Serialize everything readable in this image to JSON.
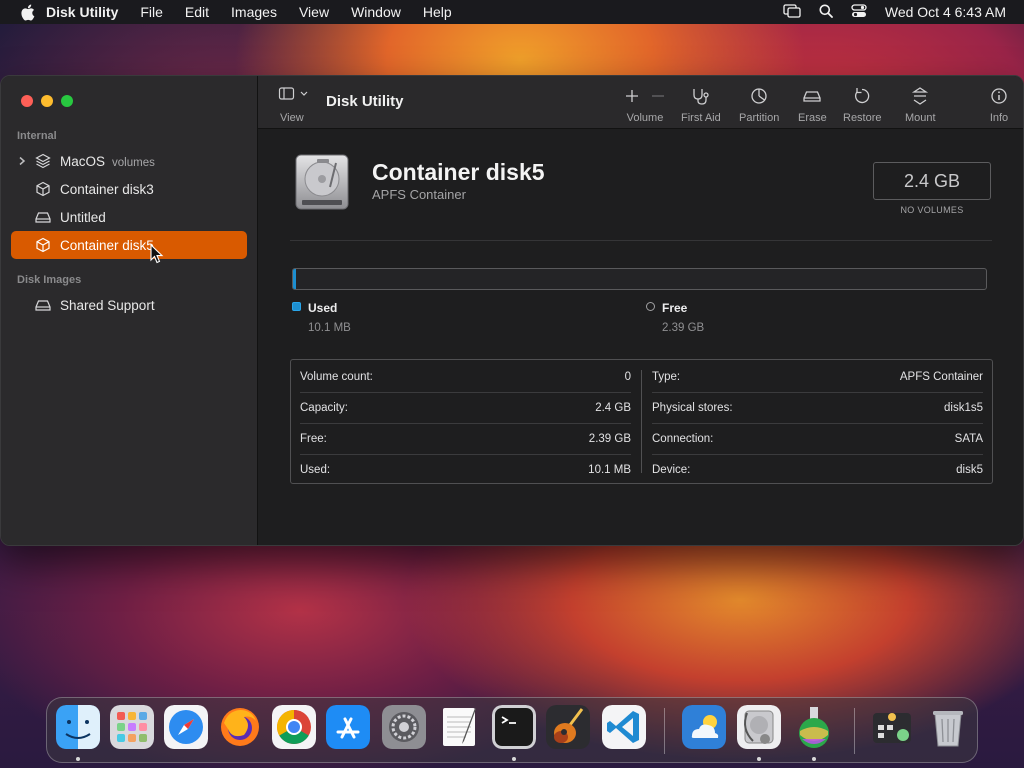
{
  "menubar": {
    "app_name": "Disk Utility",
    "items": [
      "File",
      "Edit",
      "Images",
      "View",
      "Window",
      "Help"
    ],
    "clock": "Wed Oct 4  6:43 AM"
  },
  "sidebar": {
    "section_internal": "Internal",
    "section_disk_images": "Disk Images",
    "items": [
      {
        "label": "MacOS",
        "sublabel": "volumes",
        "icon": "layers-icon"
      },
      {
        "label": "Container disk3",
        "icon": "cube-icon"
      },
      {
        "label": "Untitled",
        "icon": "drive-icon"
      },
      {
        "label": "Container disk5",
        "icon": "cube-icon",
        "selected": true
      },
      {
        "label": "Shared Support",
        "icon": "drive-icon"
      }
    ]
  },
  "toolbar": {
    "view_label": "View",
    "title": "Disk Utility",
    "volume_label": "Volume",
    "first_aid_label": "First Aid",
    "partition_label": "Partition",
    "erase_label": "Erase",
    "restore_label": "Restore",
    "mount_label": "Mount",
    "info_label": "Info"
  },
  "disk": {
    "name": "Container disk5",
    "type": "APFS Container",
    "size": "2.4 GB",
    "volumes_note": "NO VOLUMES"
  },
  "usage": {
    "used_fraction": 0.004,
    "used_title": "Used",
    "used_value": "10.1 MB",
    "used_color": "#1d8fd0",
    "free_title": "Free",
    "free_value": "2.39 GB"
  },
  "info": {
    "left": [
      {
        "key": "Volume count:",
        "value": "0"
      },
      {
        "key": "Capacity:",
        "value": "2.4 GB"
      },
      {
        "key": "Free:",
        "value": "2.39 GB"
      },
      {
        "key": "Used:",
        "value": "10.1 MB"
      }
    ],
    "right": [
      {
        "key": "Type:",
        "value": "APFS Container"
      },
      {
        "key": "Physical stores:",
        "value": "disk1s5"
      },
      {
        "key": "Connection:",
        "value": "SATA"
      },
      {
        "key": "Device:",
        "value": "disk5"
      }
    ]
  },
  "dock": {
    "apps": [
      "finder-icon",
      "launchpad-icon",
      "safari-icon",
      "firefox-icon",
      "chrome-icon",
      "app-store-icon",
      "system-settings-icon",
      "textedit-icon",
      "terminal-icon",
      "garageband-icon",
      "vscode-icon",
      "weather-icon",
      "disk-utility-icon",
      "chemistry-icon",
      "downloads-stack-icon",
      "trash-icon"
    ]
  }
}
